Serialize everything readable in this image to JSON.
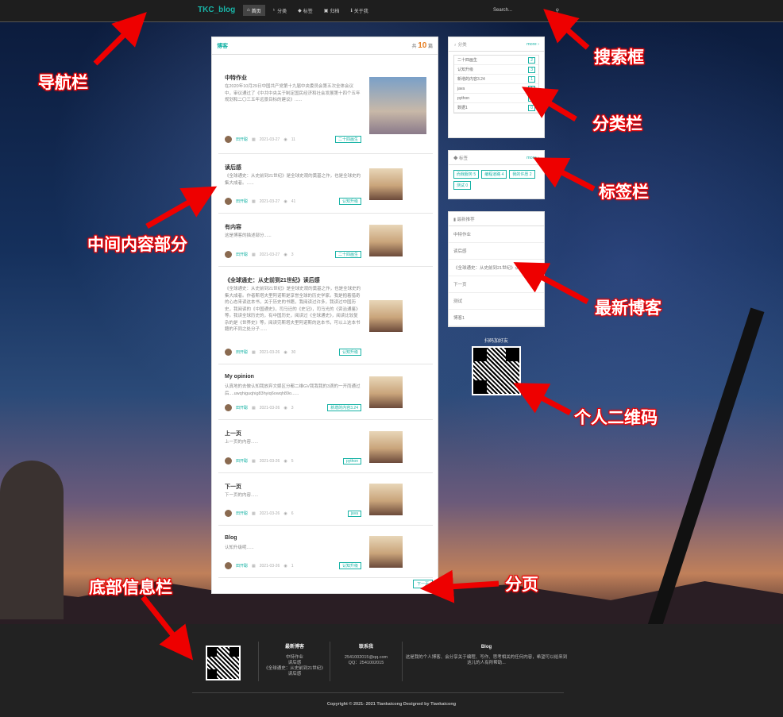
{
  "nav": {
    "brand": "TKC_blog",
    "items": [
      {
        "label": "首页",
        "icon": "home-icon",
        "active": true
      },
      {
        "label": "分类",
        "icon": "pin-icon"
      },
      {
        "label": "标签",
        "icon": "tag-icon"
      },
      {
        "label": "归档",
        "icon": "archive-icon"
      },
      {
        "label": "关于我",
        "icon": "info-icon"
      }
    ],
    "search_placeholder": "Search..."
  },
  "main": {
    "title": "博客",
    "count_prefix": "共",
    "count": "10",
    "count_suffix": "篇",
    "posts": [
      {
        "title": "中特作业",
        "excerpt": "在2020年10月29日中国共产党第十九届中央委员会第五次全体会议中，审议通过了《中共中央关于制定国民经济和社会发展第十四个五年规划和二〇三五年远景目标的建议》......",
        "author": "田开聪",
        "date": "2021-03-27",
        "views": "11",
        "tag": "二十四画生"
      },
      {
        "title": "读后感",
        "excerpt": "《全球通史：从史前到21世纪》是全球史观的奠基之作，也是全球史的集大成者。......",
        "author": "田开聪",
        "date": "2021-03-27",
        "views": "41",
        "tag": "认知升级"
      },
      {
        "title": "有内容",
        "excerpt": "这是博客的描述部分......",
        "author": "田开聪",
        "date": "2021-03-27",
        "views": "3",
        "tag": "二十四画生"
      },
      {
        "title": "《全球通史：从史前到21世纪》读后感",
        "excerpt": "《全球通史：从史前到21世纪》是全球史观的奠基之作，也是全球史的集大成者。作者斯塔夫里阿诺斯是享誉全球的历史学家。我是抱着猎奇的心态来读这本书，关于历史的书籍，我阅读过许多，我读过中国历史，我阅读的《中国通史》，司马迁的《史记》，司马光的《资治通鉴》等。我读全球历史的，有中国历史，阅读过《全球通史》，阅读比较复杂的是《世界史》等。阅读完斯塔夫里阿诺斯的这本书，可以上这本书籍的不同之处分子......",
        "author": "田开聪",
        "date": "2021-03-26",
        "views": "30",
        "tag": "认知升级"
      },
      {
        "title": "My opinion",
        "excerpt": "认真地的去做认知我放弃文娱区分都二维GV我我我的3滴的一开而通过后....uwqhiguqhig83hyiq6owqh89o......",
        "author": "田开聪",
        "date": "2021-03-26",
        "views": "3",
        "tag": "新增的内容3.24"
      },
      {
        "title": "上一页",
        "excerpt": "上一页的内容......",
        "author": "田开聪",
        "date": "2021-03-26",
        "views": "5",
        "tag": "python"
      },
      {
        "title": "下一页",
        "excerpt": "下一页的内容......",
        "author": "田开聪",
        "date": "2021-03-26",
        "views": "6",
        "tag": "java"
      },
      {
        "title": "Blog",
        "excerpt": "认知升级呢......",
        "author": "田开聪",
        "date": "2021-03-26",
        "views": "1",
        "tag": "认知升级"
      }
    ],
    "next_page": "下一页"
  },
  "categories": {
    "title": "分类",
    "more": "more",
    "items": [
      {
        "name": "二十四画生",
        "n": "2"
      },
      {
        "name": "认知升级",
        "n": "3"
      },
      {
        "name": "新增的内容3.24",
        "n": "1"
      },
      {
        "name": "java",
        "n": "1"
      },
      {
        "name": "python",
        "n": "1"
      },
      {
        "name": "数据1",
        "n": "0"
      }
    ]
  },
  "tags": {
    "title": "标签",
    "more": "more",
    "items": [
      {
        "name": "而我服务",
        "n": "5"
      },
      {
        "name": "编程道路",
        "n": "4"
      },
      {
        "name": "我的许愿",
        "n": "2"
      },
      {
        "name": "测试",
        "n": "0"
      }
    ]
  },
  "recent": {
    "title": "最新推荐",
    "items": [
      "中特作业",
      "读后感",
      "《全球通史：从史前到21世纪》读后感",
      "下一页",
      "测试",
      "博客1"
    ]
  },
  "qr_title": "扫码加好友",
  "footer": {
    "recent_title": "最新博客",
    "recent_items": [
      "中特作业",
      "读后感",
      "《全球通史：从史前到21世纪》读后感"
    ],
    "contact_title": "联系我",
    "contact_items": [
      "2541002015@qq.com",
      "QQ：2541002015"
    ],
    "blog_title": "Blog",
    "blog_text": "这是我的个人博客、会分享关于编程、写作、思考相关的任何内容，希望可以给来到这儿的人有所帮助...",
    "copyright": "Copyright © 2021- 2021 Tiankaicong Designed by Tiankaicong"
  },
  "annotations": {
    "nav": "导航栏",
    "search": "搜索框",
    "category": "分类栏",
    "tags": "标签栏",
    "middle": "中间内容部分",
    "recent": "最新博客",
    "qrcode": "个人二维码",
    "pager": "分页",
    "footer": "底部信息栏"
  },
  "colors": {
    "accent": "#19b3a6",
    "annotation": "#e00000"
  }
}
